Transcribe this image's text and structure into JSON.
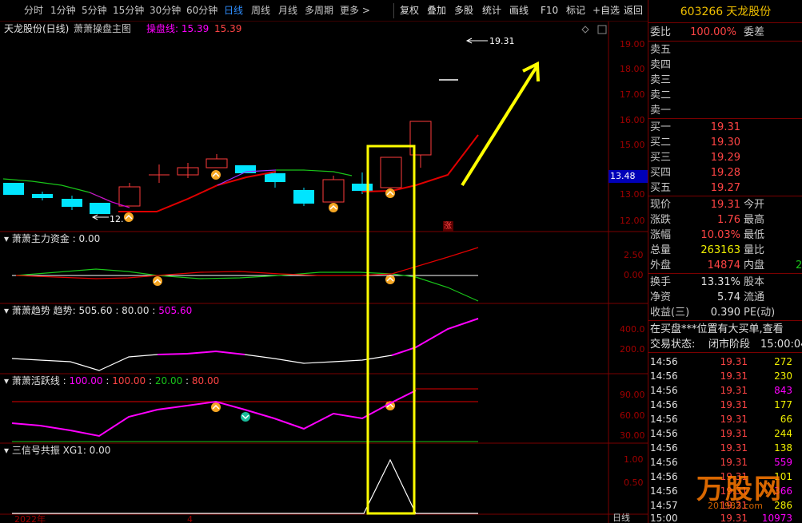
{
  "toolbar": {
    "periods": [
      "分时",
      "1分钟",
      "5分钟",
      "15分钟",
      "30分钟",
      "60分钟",
      "日线",
      "周线",
      "月线",
      "多周期",
      "更多 >"
    ],
    "active_period": "日线",
    "actions": [
      "复权",
      "叠加",
      "多股",
      "统计",
      "画线",
      "F10",
      "标记",
      "+自选",
      "返回"
    ]
  },
  "main_panel": {
    "stock_title": "天龙股份(日线)",
    "indicator_name": "萧萧操盘主图",
    "indicator_line_label": "操盘线: 15.39",
    "indicator_line_value": "15.39",
    "high_marker": "19.31",
    "low_marker": "12.",
    "current_price_tag": "13.48",
    "limit_tag": "涨",
    "y_ticks": [
      "19.00",
      "18.00",
      "17.00",
      "16.00",
      "15.00",
      "14.00",
      "13.00",
      "12.00"
    ],
    "x_labels": [
      "2022年",
      "4"
    ],
    "x_tag": "日线"
  },
  "panel_capital": {
    "title": "萧萧主力资金 : 0.00",
    "y_ticks": [
      "2.50",
      "0.00"
    ]
  },
  "panel_trend": {
    "title": "萧萧趋势 趋势: 505.60 : 80.00 :",
    "value": "505.60",
    "y_ticks": [
      "400.0",
      "200.0"
    ]
  },
  "panel_activity": {
    "title": "萧萧活跃线 :",
    "v1": "100.00",
    "v2": "100.00",
    "v3": "20.00",
    "v4": "80.00",
    "y_ticks": [
      "90.00",
      "60.00",
      "30.00"
    ]
  },
  "panel_signal": {
    "title": "三信号共振 XG1: 0.00",
    "y_ticks": [
      "1.00",
      "0.50"
    ]
  },
  "colors": {
    "up": "#ff3b3b",
    "down": "#00e5ff",
    "highlight_box": "#ffff00",
    "magenta": "#ff00ff"
  },
  "quote": {
    "code": "603266",
    "name": "天龙股份",
    "weibi_label": "委比",
    "weibi_value": "100.00%",
    "weicha_label": "委差",
    "asks": [
      {
        "label": "卖五",
        "price": ""
      },
      {
        "label": "卖四",
        "price": ""
      },
      {
        "label": "卖三",
        "price": ""
      },
      {
        "label": "卖二",
        "price": ""
      },
      {
        "label": "卖一",
        "price": ""
      }
    ],
    "bids": [
      {
        "label": "买一",
        "price": "19.31"
      },
      {
        "label": "买二",
        "price": "19.30"
      },
      {
        "label": "买三",
        "price": "19.29"
      },
      {
        "label": "买四",
        "price": "19.28"
      },
      {
        "label": "买五",
        "price": "19.27"
      }
    ],
    "stats": [
      {
        "k1": "现价",
        "v1": "19.31",
        "k2": "今开"
      },
      {
        "k1": "涨跌",
        "v1": "1.76",
        "k2": "最高"
      },
      {
        "k1": "涨幅",
        "v1": "10.03%",
        "k2": "最低"
      },
      {
        "k1": "总量",
        "v1": "263163",
        "k2": "量比"
      },
      {
        "k1": "外盘",
        "v1": "14874",
        "k2": "内盘",
        "v2": "2"
      }
    ],
    "stats2": [
      {
        "k1": "换手",
        "v1": "13.31%",
        "k2": "股本"
      },
      {
        "k1": "净资",
        "v1": "5.74",
        "k2": "流通"
      },
      {
        "k1": "收益(三)",
        "v1": "0.390",
        "k2": "PE(动)"
      }
    ],
    "notice": "在买盘***位置有大买单,查看",
    "status_label": "交易状态:",
    "status_value": "闭市阶段",
    "status_time": "15:00:04",
    "ticks": [
      {
        "t": "14:56",
        "p": "19.31",
        "v": "272",
        "c": "#f0f000"
      },
      {
        "t": "14:56",
        "p": "19.31",
        "v": "230",
        "c": "#f0f000"
      },
      {
        "t": "14:56",
        "p": "19.31",
        "v": "843",
        "c": "#ff00ff"
      },
      {
        "t": "14:56",
        "p": "19.31",
        "v": "177",
        "c": "#f0f000"
      },
      {
        "t": "14:56",
        "p": "19.31",
        "v": "66",
        "c": "#f0f000"
      },
      {
        "t": "14:56",
        "p": "19.31",
        "v": "244",
        "c": "#f0f000"
      },
      {
        "t": "14:56",
        "p": "19.31",
        "v": "138",
        "c": "#f0f000"
      },
      {
        "t": "14:56",
        "p": "19.31",
        "v": "559",
        "c": "#ff00ff"
      },
      {
        "t": "14:56",
        "p": "19.31",
        "v": "101",
        "c": "#f0f000"
      },
      {
        "t": "14:56",
        "p": "19.31",
        "v": "366",
        "c": "#ff00ff"
      },
      {
        "t": "14:57",
        "p": "19.31",
        "v": "286",
        "c": "#f0f000"
      },
      {
        "t": "15:00",
        "p": "19.31",
        "v": "10973",
        "c": "#ff00ff"
      }
    ],
    "watermark": "万股网",
    "watermark_url": "201982.com"
  }
}
